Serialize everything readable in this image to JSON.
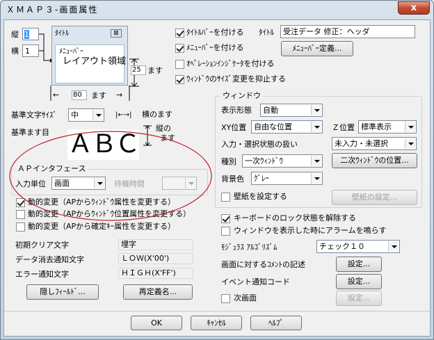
{
  "window": {
    "title": "ＸＭＡＰ３-画面属性",
    "close": "x"
  },
  "layout": {
    "vert_label": "縦",
    "vert_value": "1",
    "horiz_label": "横",
    "horiz_value": "1",
    "preview_title": "ﾀｲﾄﾙ",
    "preview_menubar": "ﾒﾆｭｰﾊﾞｰ",
    "preview_area": "レイアウト領域",
    "height_value": "25",
    "height_unit": "ます",
    "width_value": "80",
    "width_unit": "ます",
    "left_arrow": "←",
    "right_arrow": "→"
  },
  "titlebar": {
    "checkbox_label": "ﾀｲﾄﾙﾊﾞｰを付ける",
    "title_label": "ﾀｲﾄﾙ",
    "title_value": "受注データ 修正：ヘッダ"
  },
  "menubar": {
    "checkbox_label": "ﾒﾆｭｰﾊﾞｰを付ける",
    "define_button": "ﾒﾆｭｰﾊﾞｰ定義..."
  },
  "operation_indicator": {
    "checkbox_label": "ｵﾍﾟﾚｰｼｮﾝｲﾝｼﾞｹｰﾀを付ける"
  },
  "suppress_resize": {
    "checkbox_label": "ｳｨﾝﾄﾞｳのｻｲｽﾞ変更を抑止する"
  },
  "base_char_size": {
    "label": "基準文字ｻｲｽﾞ",
    "value": "中",
    "arrow": "|←→|",
    "per_mas": "横のます"
  },
  "base_mas": {
    "label": "基準ます目",
    "sample": "ＡＢＣ",
    "vertical": "縦の",
    "mas": "ます"
  },
  "ap_interface": {
    "title": "ＡＰインタフェース",
    "input_unit_label": "入力単位",
    "input_unit_value": "画面",
    "wait_label": "待機時間",
    "wait_value": ""
  },
  "dynamic": {
    "opt1": "動的変更（APからｳｨﾝﾄﾞｳ属性を変更する）",
    "opt2": "動的変更（APからｳｨﾝﾄﾞｳ位置属性を変更する）",
    "opt3": "動的変更（APから確定ｷｰ属性を変更する）"
  },
  "initial_clear": {
    "label": "初期クリア文字",
    "value": "埋字"
  },
  "data_erase": {
    "label": "データ消去通知文字",
    "value": "ＬＯＷ(X'00')"
  },
  "error_notify": {
    "label": "エラー通知文字",
    "value": "ＨＩＧＨ(X'FF')"
  },
  "buttons": {
    "hidden_field": "隠しﾌｨｰﾙﾄﾞ...",
    "redefine": "再定義名...",
    "ok": "OK",
    "cancel": "ｷｬﾝｾﾙ",
    "help": "ﾍﾙﾌﾟ"
  },
  "window_group": {
    "title": "ウィンドウ",
    "display_label": "表示形態",
    "display_value": "自動",
    "xy_label": "XY位置",
    "xy_value": "自由な位置",
    "z_label": "Ｚ位置",
    "z_value": "標準表示",
    "input_state_label": "入力・選択状態の扱い",
    "input_state_value": "未入力・未選択",
    "type_label": "種別",
    "type_value": "一次ｳｨﾝﾄﾞｳ",
    "secondary_pos_button": "二次ｳｨﾝﾄﾞｳの位置...",
    "bg_label": "背景色",
    "bg_value": "ｸﾞﾚｰ",
    "wallpaper_checkbox": "壁紙を設定する",
    "wallpaper_button": "壁紙の設定..."
  },
  "keyboard_lock": {
    "label": "キーボードのロック状態を解除する"
  },
  "alarm": {
    "label": "ウィンドウを表示した時にアラームを鳴らす"
  },
  "modulus": {
    "label": "ﾓｼﾞｭﾗｽ ｱﾙｺﾞﾘｽﾞﾑ",
    "value": "チェック１０"
  },
  "comment": {
    "label": "画面に対するｺﾒﾝﾄの記述",
    "button": "設定..."
  },
  "event": {
    "label": "イベント通知コード",
    "button": "設定..."
  },
  "next_screen": {
    "label": "次画面",
    "button": "設定..."
  },
  "colors": {
    "annotation": "#c0202a",
    "close_bg": "#c44a32"
  }
}
